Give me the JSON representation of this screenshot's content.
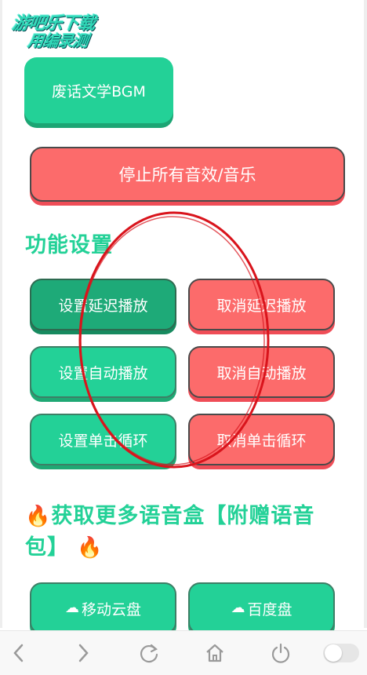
{
  "logo": {
    "line1": "游吧乐下载",
    "line2": "用编录测"
  },
  "buttons": {
    "bgm": "废话文学BGM",
    "stop_all": "停止所有音效/音乐"
  },
  "sections": {
    "settings_title": "功能设置",
    "more_title_line1": "获取更多语音盒【附赠语音",
    "more_title_line2": "包】"
  },
  "settings": {
    "set_delay": "设置延迟播放",
    "cancel_delay": "取消延迟播放",
    "set_auto": "设置自动播放",
    "cancel_auto": "取消自动播放",
    "set_loop": "设置单击循环",
    "cancel_loop": "取消单击循环"
  },
  "downloads": {
    "mobile_cloud": "移动云盘",
    "baidu": "百度盘"
  },
  "colors": {
    "green": "#23d197",
    "green_dark": "#1eaa78",
    "red": "#fc6b6b",
    "annotation": "#d9141c"
  },
  "icons": [
    "fire-icon",
    "cloud-icon",
    "back-icon",
    "forward-icon",
    "refresh-icon",
    "home-icon",
    "power-icon",
    "toggle-switch"
  ]
}
